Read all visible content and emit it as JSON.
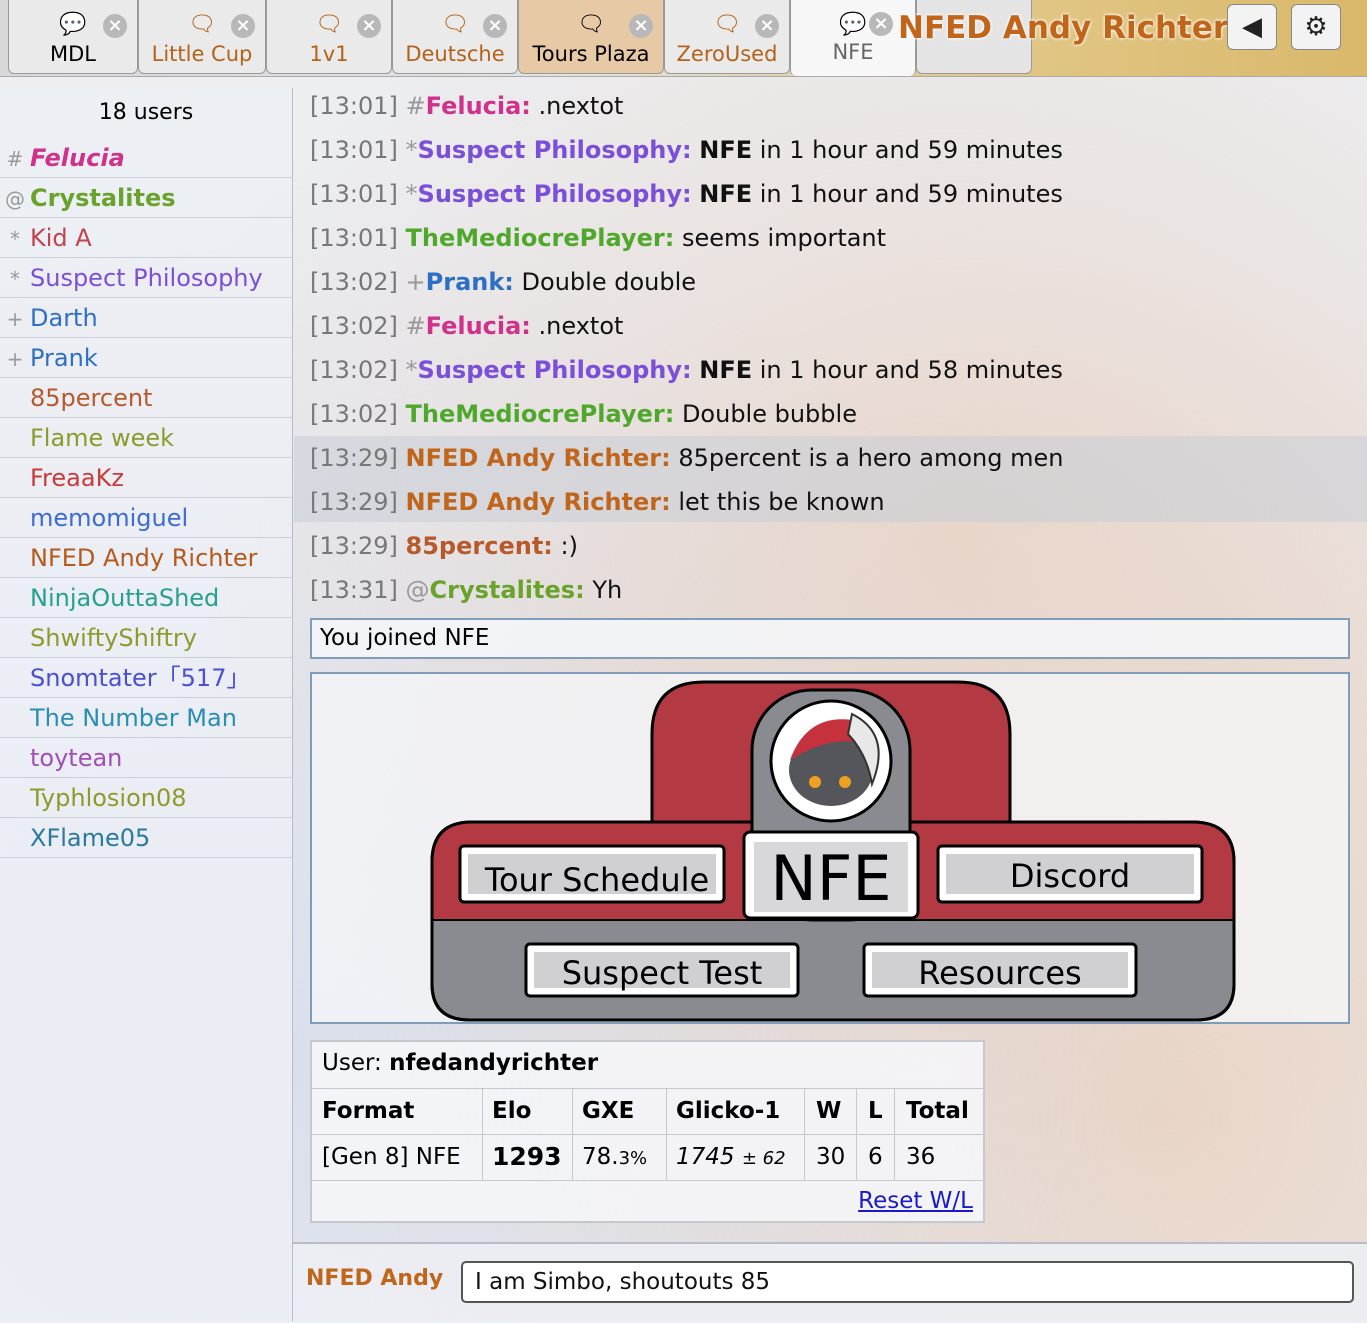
{
  "tabs": [
    {
      "label": "MDL",
      "icon": "chat-bubble-icon"
    },
    {
      "label": "Little Cup",
      "icon": "chat-bubbles-icon"
    },
    {
      "label": "1v1",
      "icon": "chat-bubbles-icon"
    },
    {
      "label": "Deutsche",
      "icon": "chat-bubbles-icon"
    },
    {
      "label": "Tours Plaza",
      "icon": "chat-bubbles-icon"
    },
    {
      "label": "ZeroUsed",
      "icon": "chat-bubbles-icon"
    },
    {
      "label": "NFE",
      "icon": "chat-users-icon"
    }
  ],
  "header": {
    "username": "NFED Andy Richter",
    "sound_icon": "speaker-icon",
    "settings_icon": "gear-icon"
  },
  "sidebar": {
    "count": "18 users",
    "users": [
      {
        "rank": "#",
        "name": "Felucia",
        "color": "#d0318b"
      },
      {
        "rank": "@",
        "name": "Crystalites",
        "color": "#6aa32b"
      },
      {
        "rank": "*",
        "name": "Kid A",
        "color": "#c2424e"
      },
      {
        "rank": "*",
        "name": "Suspect Philosophy",
        "color": "#7b4fd8"
      },
      {
        "rank": "+",
        "name": "Darth",
        "color": "#2d6fc4"
      },
      {
        "rank": "+",
        "name": "Prank",
        "color": "#2d6fc4"
      },
      {
        "rank": "",
        "name": "85percent",
        "color": "#b65a2c"
      },
      {
        "rank": "",
        "name": "Flame week",
        "color": "#8a9b2a"
      },
      {
        "rank": "",
        "name": "FreaaKz",
        "color": "#c93b3b"
      },
      {
        "rank": "",
        "name": "memomiguel",
        "color": "#3d6bd1"
      },
      {
        "rank": "",
        "name": "NFED Andy Richter",
        "color": "#b55a1c"
      },
      {
        "rank": "",
        "name": "NinjaOuttaShed",
        "color": "#27a08f"
      },
      {
        "rank": "",
        "name": "ShwiftyShiftry",
        "color": "#8e9a2b"
      },
      {
        "rank": "",
        "name": "Snomtater「517」",
        "color": "#4b4fd0"
      },
      {
        "rank": "",
        "name": "The Number Man",
        "color": "#2a8db3"
      },
      {
        "rank": "",
        "name": "toytean",
        "color": "#a04fb5"
      },
      {
        "rank": "",
        "name": "Typhlosion08",
        "color": "#8f9a2a"
      },
      {
        "rank": "",
        "name": "XFlame05",
        "color": "#2a7a9b"
      }
    ]
  },
  "messages": [
    {
      "ts": "[13:01]",
      "rank": "#",
      "name": "Felucia:",
      "color": "#d0318b",
      "text": ".nextot",
      "bold_lead": ""
    },
    {
      "ts": "[13:01]",
      "rank": "*",
      "name": "Suspect Philosophy:",
      "color": "#7b4fd8",
      "bold_lead": "NFE",
      "text": " in 1 hour and 59 minutes"
    },
    {
      "ts": "[13:01]",
      "rank": "*",
      "name": "Suspect Philosophy:",
      "color": "#7b4fd8",
      "bold_lead": "NFE",
      "text": " in 1 hour and 59 minutes"
    },
    {
      "ts": "[13:01]",
      "rank": "",
      "name": "TheMediocrePlayer:",
      "color": "#4fa82b",
      "bold_lead": "",
      "text": "seems important"
    },
    {
      "ts": "[13:02]",
      "rank": "+",
      "name": "Prank:",
      "color": "#2d6fc4",
      "bold_lead": "",
      "text": "Double double"
    },
    {
      "ts": "[13:02]",
      "rank": "#",
      "name": "Felucia:",
      "color": "#d0318b",
      "bold_lead": "",
      "text": ".nextot"
    },
    {
      "ts": "[13:02]",
      "rank": "*",
      "name": "Suspect Philosophy:",
      "color": "#7b4fd8",
      "bold_lead": "NFE",
      "text": " in 1 hour and 58 minutes"
    },
    {
      "ts": "[13:02]",
      "rank": "",
      "name": "TheMediocrePlayer:",
      "color": "#4fa82b",
      "bold_lead": "",
      "text": "Double bubble"
    },
    {
      "ts": "[13:29]",
      "rank": "",
      "name": "NFED Andy Richter:",
      "color": "#c0651a",
      "bold_lead": "",
      "text": "85percent is a hero among men"
    },
    {
      "ts": "[13:29]",
      "rank": "",
      "name": "NFED Andy Richter:",
      "color": "#c0651a",
      "bold_lead": "",
      "text": "let this be known"
    },
    {
      "ts": "[13:29]",
      "rank": "",
      "name": "85percent:",
      "color": "#b65a2c",
      "bold_lead": "",
      "text": ":)"
    },
    {
      "ts": "[13:31]",
      "rank": "@",
      "name": "Crystalites:",
      "color": "#6aa32b",
      "bold_lead": "",
      "text": "Yh"
    }
  ],
  "joined": "You joined NFE",
  "banner": {
    "title": "NFE",
    "buttons": [
      "Tour Schedule",
      "Discord",
      "Suspect Test",
      "Resources"
    ],
    "mascot_icon": "pokemon-mascot-icon"
  },
  "stats": {
    "user_label": "User:",
    "user": "nfedandyrichter",
    "headers": [
      "Format",
      "Elo",
      "GXE",
      "Glicko-1",
      "W",
      "L",
      "Total"
    ],
    "row": {
      "format": "[Gen 8] NFE",
      "elo": "1293",
      "gxe": "78.",
      "gxe_small": "3%",
      "glicko": "1745",
      "glicko_dev": "± 62",
      "w": "30",
      "l": "6",
      "total": "36"
    },
    "reset": "Reset W/L"
  },
  "input": {
    "name": "NFED Andy",
    "value": "I am Simbo, shoutouts 85"
  }
}
